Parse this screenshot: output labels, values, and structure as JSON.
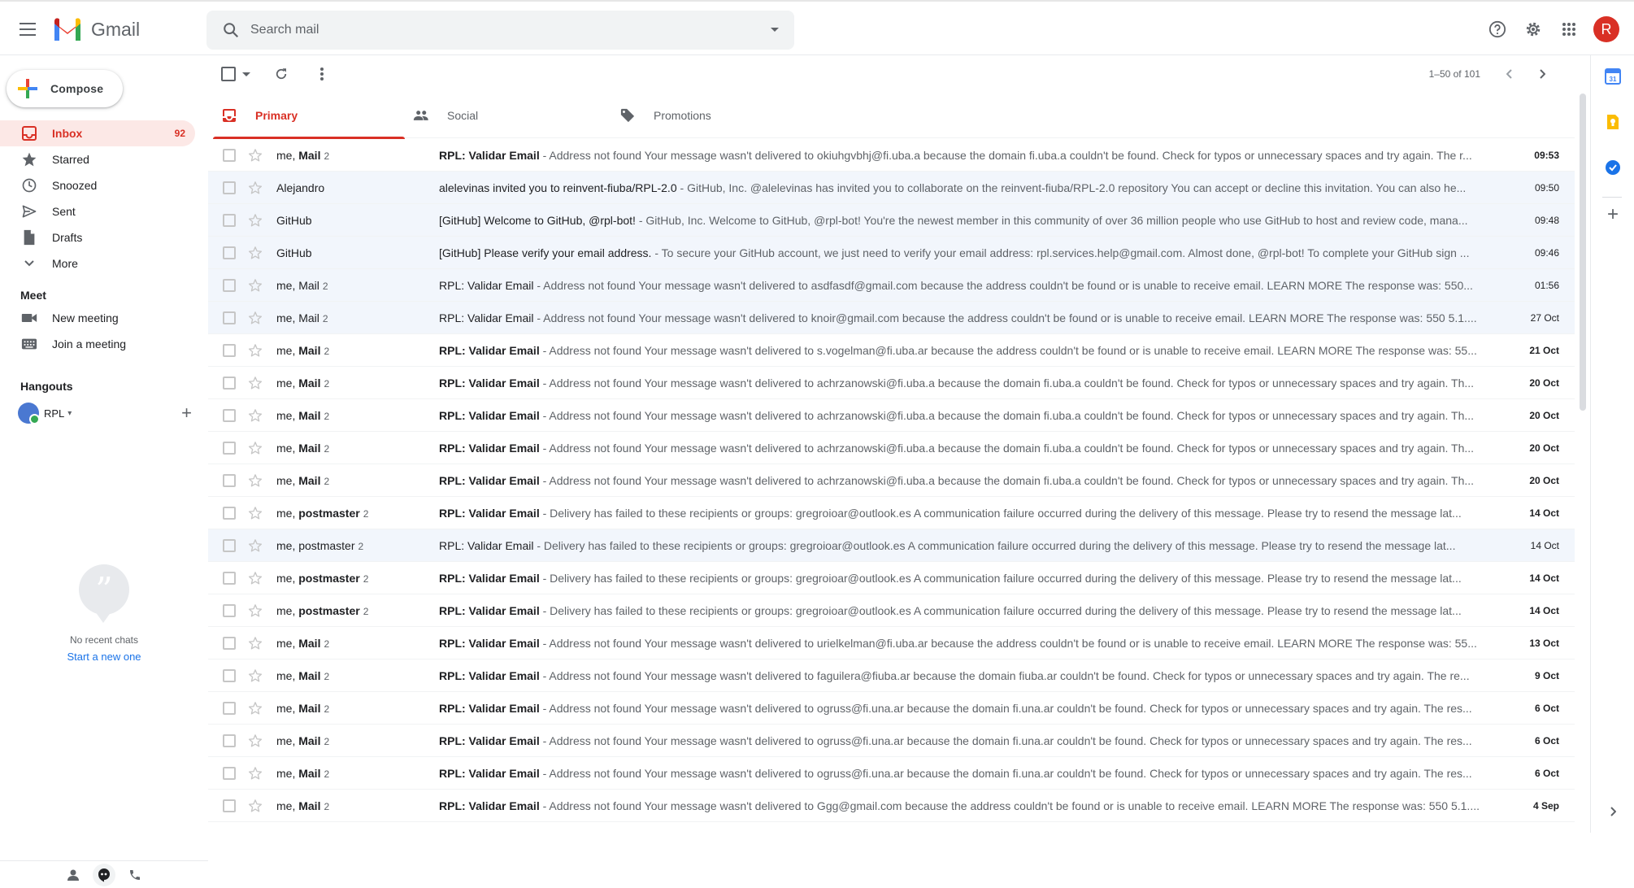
{
  "app": {
    "name": "Gmail"
  },
  "search": {
    "placeholder": "Search mail"
  },
  "compose_label": "Compose",
  "nav": [
    {
      "label": "Inbox",
      "count": "92",
      "icon": "inbox-icon",
      "active": true
    },
    {
      "label": "Starred",
      "count": "",
      "icon": "star-icon"
    },
    {
      "label": "Snoozed",
      "count": "",
      "icon": "clock-icon"
    },
    {
      "label": "Sent",
      "count": "",
      "icon": "send-icon"
    },
    {
      "label": "Drafts",
      "count": "",
      "icon": "draft-icon"
    },
    {
      "label": "More",
      "count": "",
      "icon": "chevron-down-icon"
    }
  ],
  "meet": {
    "title": "Meet",
    "items": [
      {
        "label": "New meeting",
        "icon": "video-icon"
      },
      {
        "label": "Join a meeting",
        "icon": "keyboard-icon"
      }
    ]
  },
  "hangouts": {
    "title": "Hangouts",
    "user": "RPL",
    "no_chats": "No recent chats",
    "start_new": "Start a new one"
  },
  "toolbar": {
    "pager": "1–50 of 101"
  },
  "tabs": [
    {
      "label": "Primary",
      "icon": "inbox-icon",
      "active": true
    },
    {
      "label": "Social",
      "icon": "people-icon"
    },
    {
      "label": "Promotions",
      "icon": "tag-icon"
    }
  ],
  "accent_color": "#d93025",
  "emails": [
    {
      "sender_pre": "me, ",
      "sender_name": "Mail",
      "count": "2",
      "subject": "RPL: Validar Email",
      "snippet": " - Address not found Your message wasn't delivered to okiuhgvbhj@fi.uba.a because the domain fi.uba.a couldn't be found. Check for typos or unnecessary spaces and try again. The r...",
      "date": "09:53",
      "unread": true
    },
    {
      "sender_pre": "Alejandro",
      "sender_name": "",
      "count": "",
      "subject": "alelevinas invited you to reinvent-fiuba/RPL-2.0",
      "snippet": " - GitHub, Inc. @alelevinas has invited you to collaborate on the reinvent-fiuba/RPL-2.0 repository You can accept or decline this invitation. You can also he...",
      "date": "09:50",
      "unread": false
    },
    {
      "sender_pre": "GitHub",
      "sender_name": "",
      "count": "",
      "subject": "[GitHub] Welcome to GitHub, @rpl-bot!",
      "snippet": " - GitHub, Inc. Welcome to GitHub, @rpl-bot! You're the newest member in this community of over 36 million people who use GitHub to host and review code, mana...",
      "date": "09:48",
      "unread": false
    },
    {
      "sender_pre": "GitHub",
      "sender_name": "",
      "count": "",
      "subject": "[GitHub] Please verify your email address.",
      "snippet": " - To secure your GitHub account, we just need to verify your email address: rpl.services.help@gmail.com. Almost done, @rpl-bot! To complete your GitHub sign ...",
      "date": "09:46",
      "unread": false
    },
    {
      "sender_pre": "me, Mail",
      "sender_name": "",
      "count": "2",
      "subject": "RPL: Validar Email",
      "snippet": " - Address not found Your message wasn't delivered to asdfasdf@gmail.com because the address couldn't be found or is unable to receive email. LEARN MORE The response was: 550...",
      "date": "01:56",
      "unread": false
    },
    {
      "sender_pre": "me, Mail",
      "sender_name": "",
      "count": "2",
      "subject": "RPL: Validar Email",
      "snippet": " - Address not found Your message wasn't delivered to knoir@gmail.com because the address couldn't be found or is unable to receive email. LEARN MORE The response was: 550 5.1....",
      "date": "27 Oct",
      "unread": false
    },
    {
      "sender_pre": "me, ",
      "sender_name": "Mail",
      "count": "2",
      "subject": "RPL: Validar Email",
      "snippet": " - Address not found Your message wasn't delivered to s.vogelman@fi.uba.ar because the address couldn't be found or is unable to receive email. LEARN MORE The response was: 55...",
      "date": "21 Oct",
      "unread": true
    },
    {
      "sender_pre": "me, ",
      "sender_name": "Mail",
      "count": "2",
      "subject": "RPL: Validar Email",
      "snippet": " - Address not found Your message wasn't delivered to achrzanowski@fi.uba.a because the domain fi.uba.a couldn't be found. Check for typos or unnecessary spaces and try again. Th...",
      "date": "20 Oct",
      "unread": true
    },
    {
      "sender_pre": "me, ",
      "sender_name": "Mail",
      "count": "2",
      "subject": "RPL: Validar Email",
      "snippet": " - Address not found Your message wasn't delivered to achrzanowski@fi.uba.a because the domain fi.uba.a couldn't be found. Check for typos or unnecessary spaces and try again. Th...",
      "date": "20 Oct",
      "unread": true
    },
    {
      "sender_pre": "me, ",
      "sender_name": "Mail",
      "count": "2",
      "subject": "RPL: Validar Email",
      "snippet": " - Address not found Your message wasn't delivered to achrzanowski@fi.uba.a because the domain fi.uba.a couldn't be found. Check for typos or unnecessary spaces and try again. Th...",
      "date": "20 Oct",
      "unread": true
    },
    {
      "sender_pre": "me, ",
      "sender_name": "Mail",
      "count": "2",
      "subject": "RPL: Validar Email",
      "snippet": " - Address not found Your message wasn't delivered to achrzanowski@fi.uba.a because the domain fi.uba.a couldn't be found. Check for typos or unnecessary spaces and try again. Th...",
      "date": "20 Oct",
      "unread": true
    },
    {
      "sender_pre": "me, ",
      "sender_name": "postmaster",
      "count": "2",
      "subject": "RPL: Validar Email",
      "snippet": " - Delivery has failed to these recipients or groups: gregroioar@outlook.es A communication failure occurred during the delivery of this message. Please try to resend the message lat...",
      "date": "14 Oct",
      "unread": true
    },
    {
      "sender_pre": "me, postmaster",
      "sender_name": "",
      "count": "2",
      "subject": "RPL: Validar Email",
      "snippet": " - Delivery has failed to these recipients or groups: gregroioar@outlook.es A communication failure occurred during the delivery of this message. Please try to resend the message lat...",
      "date": "14 Oct",
      "unread": false
    },
    {
      "sender_pre": "me, ",
      "sender_name": "postmaster",
      "count": "2",
      "subject": "RPL: Validar Email",
      "snippet": " - Delivery has failed to these recipients or groups: gregroioar@outlook.es A communication failure occurred during the delivery of this message. Please try to resend the message lat...",
      "date": "14 Oct",
      "unread": true
    },
    {
      "sender_pre": "me, ",
      "sender_name": "postmaster",
      "count": "2",
      "subject": "RPL: Validar Email",
      "snippet": " - Delivery has failed to these recipients or groups: gregroioar@outlook.es A communication failure occurred during the delivery of this message. Please try to resend the message lat...",
      "date": "14 Oct",
      "unread": true
    },
    {
      "sender_pre": "me, ",
      "sender_name": "Mail",
      "count": "2",
      "subject": "RPL: Validar Email",
      "snippet": " - Address not found Your message wasn't delivered to urielkelman@fi.uba.ar because the address couldn't be found or is unable to receive email. LEARN MORE The response was: 55...",
      "date": "13 Oct",
      "unread": true
    },
    {
      "sender_pre": "me, ",
      "sender_name": "Mail",
      "count": "2",
      "subject": "RPL: Validar Email",
      "snippet": " - Address not found Your message wasn't delivered to faguilera@fiuba.ar because the domain fiuba.ar couldn't be found. Check for typos or unnecessary spaces and try again. The re...",
      "date": "9 Oct",
      "unread": true
    },
    {
      "sender_pre": "me, ",
      "sender_name": "Mail",
      "count": "2",
      "subject": "RPL: Validar Email",
      "snippet": " - Address not found Your message wasn't delivered to ogruss@fi.una.ar because the domain fi.una.ar couldn't be found. Check for typos or unnecessary spaces and try again. The res...",
      "date": "6 Oct",
      "unread": true
    },
    {
      "sender_pre": "me, ",
      "sender_name": "Mail",
      "count": "2",
      "subject": "RPL: Validar Email",
      "snippet": " - Address not found Your message wasn't delivered to ogruss@fi.una.ar because the domain fi.una.ar couldn't be found. Check for typos or unnecessary spaces and try again. The res...",
      "date": "6 Oct",
      "unread": true
    },
    {
      "sender_pre": "me, ",
      "sender_name": "Mail",
      "count": "2",
      "subject": "RPL: Validar Email",
      "snippet": " - Address not found Your message wasn't delivered to ogruss@fi.una.ar because the domain fi.una.ar couldn't be found. Check for typos or unnecessary spaces and try again. The res...",
      "date": "6 Oct",
      "unread": true
    },
    {
      "sender_pre": "me, ",
      "sender_name": "Mail",
      "count": "2",
      "subject": "RPL: Validar Email",
      "snippet": " - Address not found Your message wasn't delivered to Ggg@gmail.com because the address couldn't be found or is unable to receive email. LEARN MORE The response was: 550 5.1....",
      "date": "4 Sep",
      "unread": true
    }
  ]
}
